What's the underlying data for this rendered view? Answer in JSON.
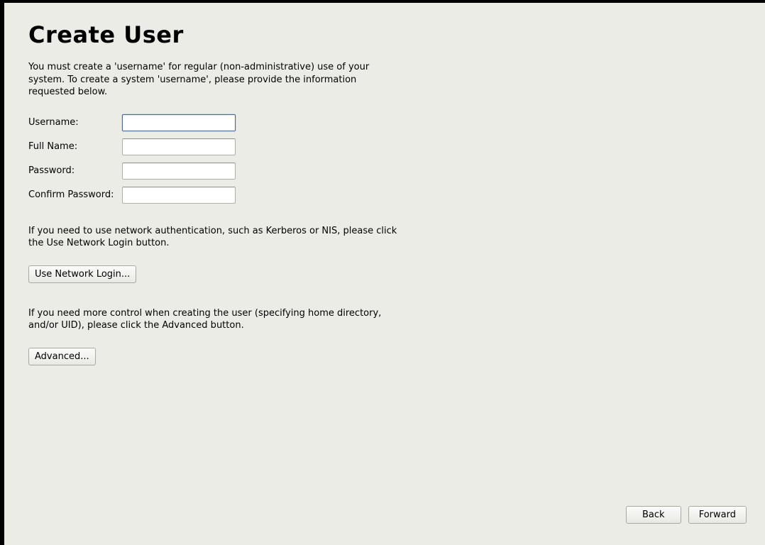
{
  "title": "Create User",
  "description": "You must create a 'username' for regular (non-administrative) use of your system.  To create a system 'username', please provide the information requested below.",
  "fields": {
    "username": {
      "label": "Username:",
      "value": ""
    },
    "fullname": {
      "label": "Full Name:",
      "value": ""
    },
    "password": {
      "label": "Password:",
      "value": ""
    },
    "confirm": {
      "label": "Confirm Password:",
      "value": ""
    }
  },
  "network_hint": "If you need to use network authentication, such as Kerberos or NIS, please click the Use Network Login button.",
  "network_button": "Use Network Login...",
  "advanced_hint": "If you need more control when creating the user (specifying home directory, and/or UID), please click the Advanced button.",
  "advanced_button": "Advanced...",
  "nav": {
    "back": "Back",
    "forward": "Forward"
  }
}
